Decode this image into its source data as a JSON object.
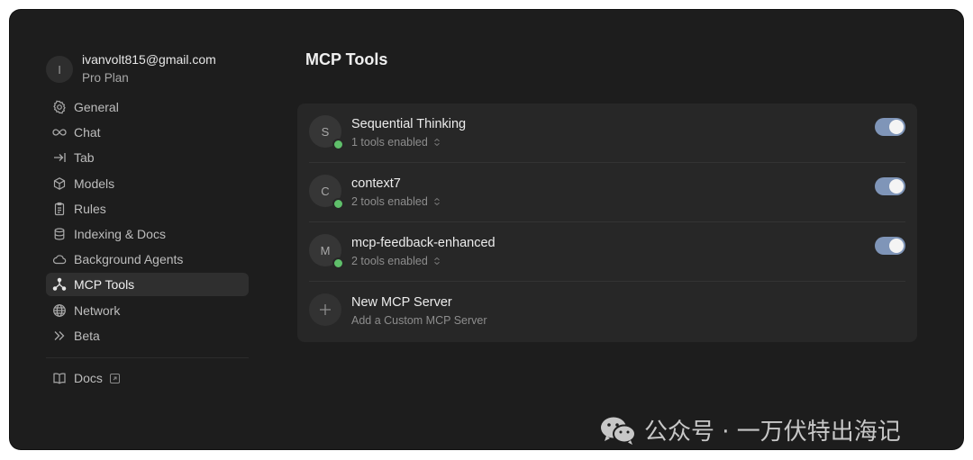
{
  "account": {
    "avatar_initial": "I",
    "email": "ivanvolt815@gmail.com",
    "plan": "Pro Plan"
  },
  "sidebar": {
    "items": [
      {
        "label": "General",
        "icon": "gear-icon"
      },
      {
        "label": "Chat",
        "icon": "infinity-icon"
      },
      {
        "label": "Tab",
        "icon": "tab-arrow-icon"
      },
      {
        "label": "Models",
        "icon": "cube-icon"
      },
      {
        "label": "Rules",
        "icon": "clipboard-icon"
      },
      {
        "label": "Indexing & Docs",
        "icon": "database-icon"
      },
      {
        "label": "Background Agents",
        "icon": "cloud-icon"
      },
      {
        "label": "MCP Tools",
        "icon": "mcp-nodes-icon",
        "active": true
      },
      {
        "label": "Network",
        "icon": "globe-icon"
      },
      {
        "label": "Beta",
        "icon": "double-chevron-icon"
      }
    ],
    "docs_label": "Docs"
  },
  "main": {
    "title": "MCP Tools",
    "servers": [
      {
        "initial": "S",
        "name": "Sequential Thinking",
        "tools": "1 tools enabled",
        "enabled": true,
        "status": "connected"
      },
      {
        "initial": "C",
        "name": "context7",
        "tools": "2 tools enabled",
        "enabled": true,
        "status": "connected"
      },
      {
        "initial": "M",
        "name": "mcp-feedback-enhanced",
        "tools": "2 tools enabled",
        "enabled": true,
        "status": "connected"
      }
    ],
    "new_server": {
      "title": "New MCP Server",
      "subtitle": "Add a Custom MCP Server"
    }
  },
  "colors": {
    "window_bg": "#1d1d1d",
    "panel_bg": "#272727",
    "toggle_on": "#7f95b8",
    "status_green": "#5fbf6a"
  },
  "watermark": {
    "text": "公众号 · 一万伏特出海记"
  }
}
